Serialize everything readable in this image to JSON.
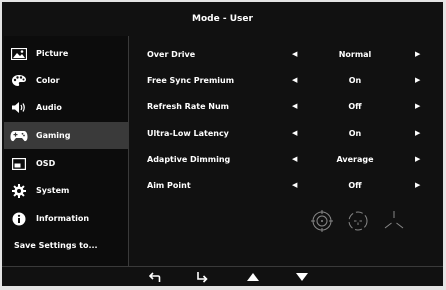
{
  "title": "Mode - User",
  "sidebar": {
    "items": [
      {
        "label": "Picture",
        "icon": "picture-icon"
      },
      {
        "label": "Color",
        "icon": "palette-icon"
      },
      {
        "label": "Audio",
        "icon": "speaker-icon"
      },
      {
        "label": "Gaming",
        "icon": "gamepad-icon",
        "active": true
      },
      {
        "label": "OSD",
        "icon": "osd-icon"
      },
      {
        "label": "System",
        "icon": "gear-icon"
      },
      {
        "label": "Information",
        "icon": "info-icon"
      }
    ],
    "save_label": "Save Settings to..."
  },
  "settings": [
    {
      "name": "Over Drive",
      "value": "Normal"
    },
    {
      "name": "Free Sync Premium",
      "value": "On"
    },
    {
      "name": "Refresh Rate Num",
      "value": "Off"
    },
    {
      "name": "Ultra-Low Latency",
      "value": "On"
    },
    {
      "name": "Adaptive Dimming",
      "value": "Average"
    },
    {
      "name": "Aim Point",
      "value": "Off"
    }
  ],
  "aim_point_icons": [
    "crosshair-circle-icon",
    "crosshair-dashed-icon",
    "crosshair-lines-icon"
  ],
  "nav_buttons": [
    "back-icon",
    "enter-icon",
    "up-arrow-icon",
    "down-arrow-icon"
  ],
  "colors": {
    "background": "#111111",
    "active_item": "#3a3a3a",
    "text": "#ffffff"
  }
}
